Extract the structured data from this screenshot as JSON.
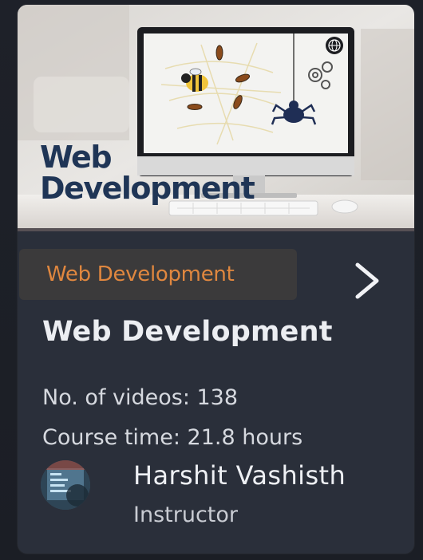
{
  "thumbnail": {
    "title_line1": "Web",
    "title_line2": "Development",
    "title_color": "#1f3556"
  },
  "course": {
    "category_tag": "Web Development",
    "title": "Web Development",
    "videos_text": "No. of videos: 138",
    "time_text": "Course time: 21.8 hours"
  },
  "instructor": {
    "name": "Harshit Vashisth",
    "role": "Instructor"
  },
  "colors": {
    "card_bg": "#2a2f3a",
    "tag_bg": "#3b3a3b",
    "tag_text": "#e0873f",
    "title_text": "#eceef2"
  },
  "icons": {
    "next": "chevron-right-icon",
    "screen_badge": "globe-icon"
  }
}
